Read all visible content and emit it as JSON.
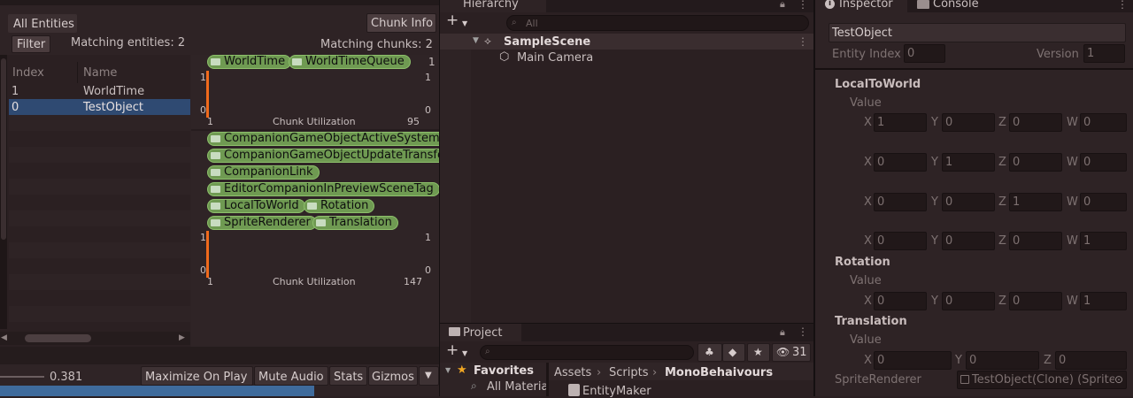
{
  "entity_debugger": {
    "tab_all_entities": "All Entities",
    "chunk_info_button": "Chunk Info",
    "filter_button": "Filter",
    "matching_entities": "Matching entities: 2",
    "matching_chunks": "Matching chunks: 2",
    "columns": {
      "index": "Index",
      "name": "Name"
    },
    "rows": [
      {
        "index": "1",
        "name": "WorldTime"
      },
      {
        "index": "0",
        "name": "TestObject"
      }
    ],
    "chunk1": {
      "components": [
        "WorldTime",
        "WorldTimeQueue"
      ],
      "y_top": "1",
      "y_bottom": "0",
      "x_left": "1",
      "x_label": "Chunk Utilization",
      "x_right": "95",
      "right_top": "1",
      "right_top2": "1",
      "right_bottom": "0",
      "utilization": 0.01
    },
    "chunk2": {
      "components": [
        "CompanionGameObjectActiveSystemState",
        "CompanionGameObjectUpdateTransformSystemState",
        "CompanionLink",
        "EditorCompanionInPreviewSceneTag",
        "LocalToWorld",
        "Rotation",
        "SpriteRenderer",
        "Translation"
      ],
      "y_top": "1",
      "y_bottom": "0",
      "x_left": "1",
      "x_label": "Chunk Utilization",
      "x_right": "147",
      "right_top": "1",
      "right_bottom": "0",
      "utilization": 0.01
    }
  },
  "game_toolbar": {
    "scale_value": "0.381",
    "maximize": "Maximize On Play",
    "mute": "Mute Audio",
    "stats": "Stats",
    "gizmos": "Gizmos"
  },
  "hierarchy": {
    "title": "Hierarchy",
    "search_placeholder": "All",
    "scene": "SampleScene",
    "items": [
      "Main Camera"
    ]
  },
  "project": {
    "title": "Project",
    "favorites": "Favorites",
    "fav_items": [
      "All Materia"
    ],
    "breadcrumb": [
      "Assets",
      "Scripts",
      "MonoBehaivours"
    ],
    "hidden_count": "31",
    "files": [
      "EntityMaker"
    ]
  },
  "inspector": {
    "tab_inspector": "Inspector",
    "tab_console": "Console",
    "object_name": "TestObject",
    "entity_index_label": "Entity Index",
    "entity_index": "0",
    "version_label": "Version",
    "version": "1",
    "local_to_world": {
      "title": "LocalToWorld",
      "value_label": "Value",
      "rows": [
        [
          "1",
          "0",
          "0",
          "0"
        ],
        [
          "0",
          "1",
          "0",
          "0"
        ],
        [
          "0",
          "0",
          "1",
          "0"
        ],
        [
          "0",
          "0",
          "0",
          "1"
        ]
      ]
    },
    "rotation": {
      "title": "Rotation",
      "value_label": "Value",
      "row": [
        "0",
        "0",
        "0",
        "1"
      ]
    },
    "translation": {
      "title": "Translation",
      "value_label": "Value",
      "row": [
        "0",
        "0",
        "0"
      ]
    },
    "axis": {
      "x": "X",
      "y": "Y",
      "z": "Z",
      "w": "W"
    },
    "sprite_renderer_label": "SpriteRenderer",
    "sprite_renderer_value": "TestObject(Clone) (Sprite"
  },
  "colors": {
    "accent": "#f06a1c",
    "tag_green": "#6f9a52",
    "selection": "#2f4a72",
    "blue_bar": "#3f6b9c"
  }
}
